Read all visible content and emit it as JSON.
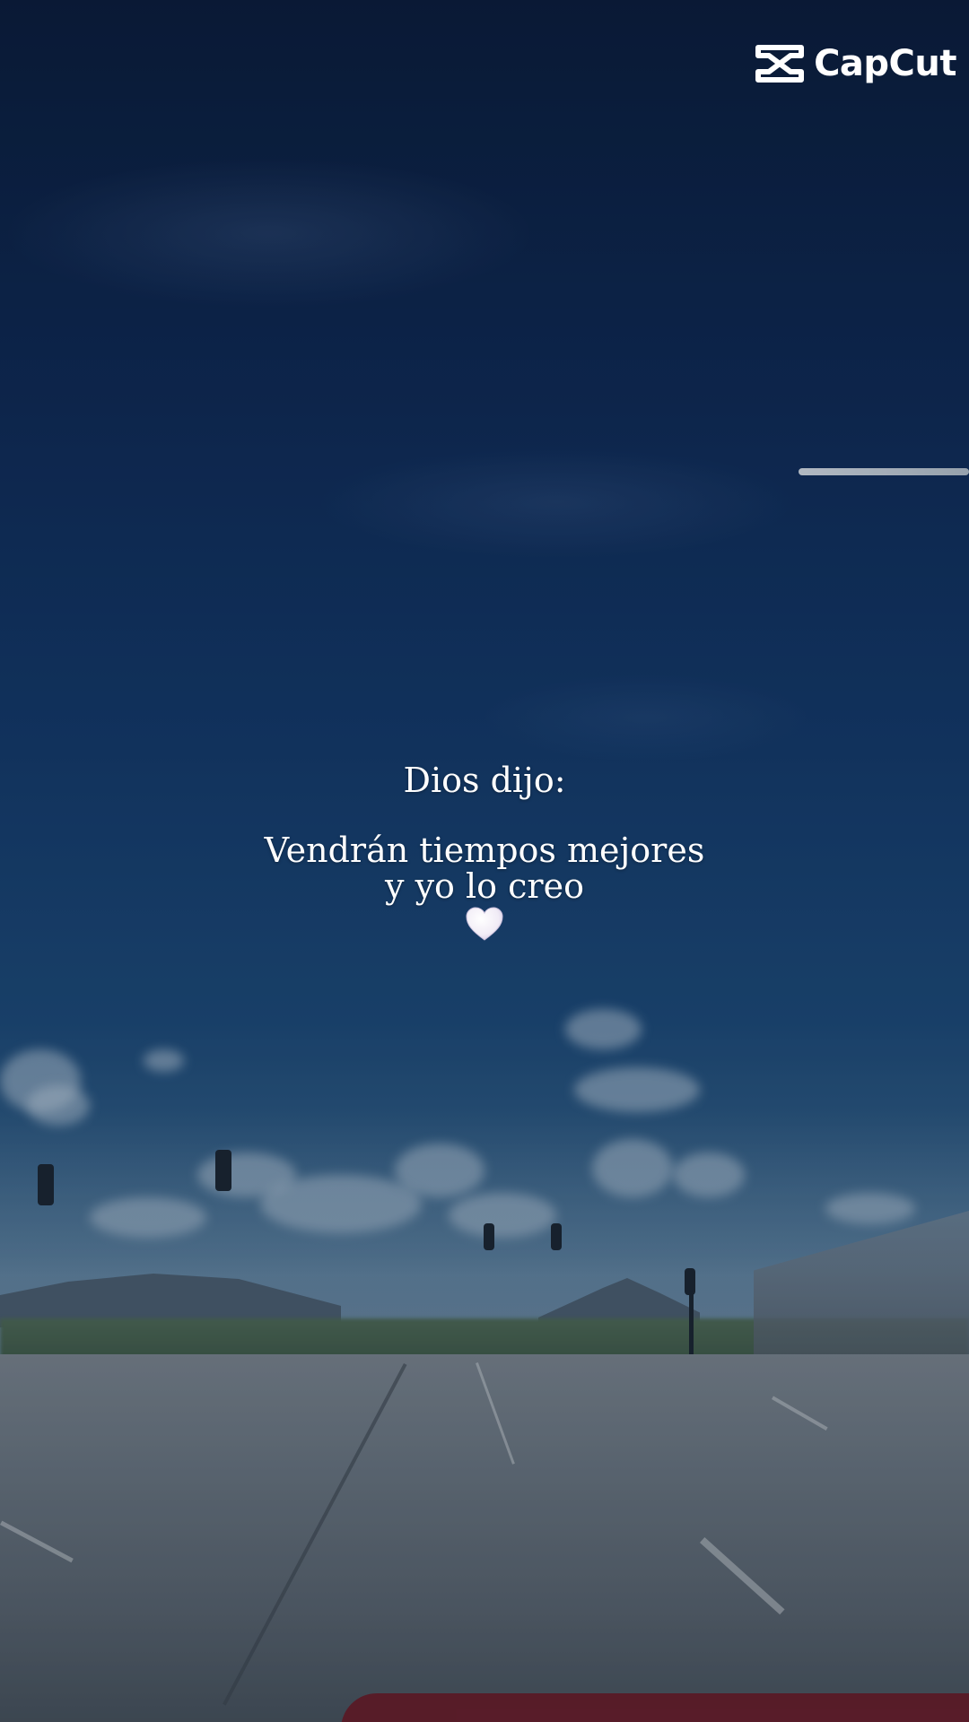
{
  "logo": {
    "text": "CapCut",
    "icon": "capcut-logo-icon"
  },
  "caption": {
    "line1": "Dios dijo:",
    "line2": "Vendrán tiempos mejores",
    "line3": "y yo lo creo",
    "emoji": "white-heart-icon"
  },
  "colors": {
    "sky_top": "#0b1c3a",
    "sky_bottom": "#6f8da3",
    "text": "#ffffff"
  }
}
